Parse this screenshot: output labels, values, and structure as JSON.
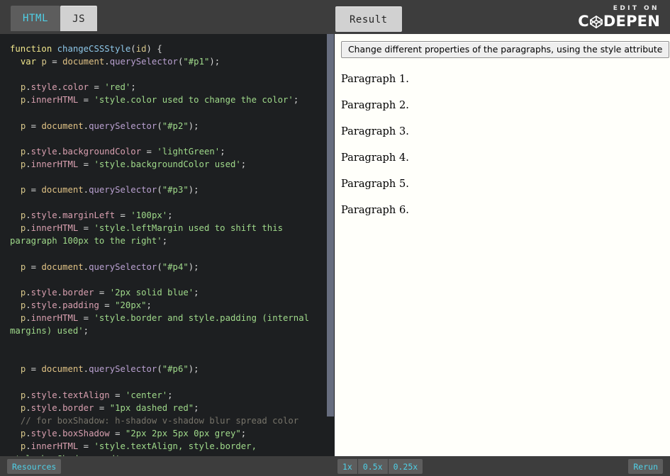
{
  "header": {
    "tabs": [
      {
        "label": "HTML",
        "active": false
      },
      {
        "label": "JS",
        "active": true
      }
    ],
    "result_tab_label": "Result",
    "brand": {
      "edit_on": "EDIT ON",
      "name_left": "C",
      "name_right": "DEPEN",
      "logo_icon": "codepen-logo-icon"
    }
  },
  "editor": {
    "language": "JavaScript",
    "lines": [
      {
        "tokens": [
          {
            "t": "function",
            "c": "kw"
          },
          {
            "t": " ",
            "c": "punc"
          },
          {
            "t": "changeCSSStyle",
            "c": "fn"
          },
          {
            "t": "(",
            "c": "punc"
          },
          {
            "t": "id",
            "c": "var"
          },
          {
            "t": ") {",
            "c": "punc"
          }
        ]
      },
      {
        "tokens": [
          {
            "t": "  ",
            "c": "punc"
          },
          {
            "t": "var",
            "c": "kw"
          },
          {
            "t": " ",
            "c": "punc"
          },
          {
            "t": "p",
            "c": "var"
          },
          {
            "t": " = ",
            "c": "op"
          },
          {
            "t": "document",
            "c": "obj"
          },
          {
            "t": ".",
            "c": "punc"
          },
          {
            "t": "querySelector",
            "c": "method"
          },
          {
            "t": "(",
            "c": "punc"
          },
          {
            "t": "\"#p1\"",
            "c": "str"
          },
          {
            "t": ");",
            "c": "punc"
          }
        ]
      },
      {
        "tokens": []
      },
      {
        "tokens": [
          {
            "t": "  ",
            "c": "punc"
          },
          {
            "t": "p",
            "c": "var"
          },
          {
            "t": ".",
            "c": "punc"
          },
          {
            "t": "style",
            "c": "prop"
          },
          {
            "t": ".",
            "c": "punc"
          },
          {
            "t": "color",
            "c": "prop"
          },
          {
            "t": " = ",
            "c": "op"
          },
          {
            "t": "'red'",
            "c": "str"
          },
          {
            "t": ";",
            "c": "punc"
          }
        ]
      },
      {
        "tokens": [
          {
            "t": "  ",
            "c": "punc"
          },
          {
            "t": "p",
            "c": "var"
          },
          {
            "t": ".",
            "c": "punc"
          },
          {
            "t": "innerHTML",
            "c": "prop"
          },
          {
            "t": " = ",
            "c": "op"
          },
          {
            "t": "'style.color used to change the color'",
            "c": "str"
          },
          {
            "t": ";",
            "c": "punc"
          }
        ]
      },
      {
        "tokens": []
      },
      {
        "tokens": [
          {
            "t": "  ",
            "c": "punc"
          },
          {
            "t": "p",
            "c": "var"
          },
          {
            "t": " = ",
            "c": "op"
          },
          {
            "t": "document",
            "c": "obj"
          },
          {
            "t": ".",
            "c": "punc"
          },
          {
            "t": "querySelector",
            "c": "method"
          },
          {
            "t": "(",
            "c": "punc"
          },
          {
            "t": "\"#p2\"",
            "c": "str"
          },
          {
            "t": ");",
            "c": "punc"
          }
        ]
      },
      {
        "tokens": []
      },
      {
        "tokens": [
          {
            "t": "  ",
            "c": "punc"
          },
          {
            "t": "p",
            "c": "var"
          },
          {
            "t": ".",
            "c": "punc"
          },
          {
            "t": "style",
            "c": "prop"
          },
          {
            "t": ".",
            "c": "punc"
          },
          {
            "t": "backgroundColor",
            "c": "prop"
          },
          {
            "t": " = ",
            "c": "op"
          },
          {
            "t": "'lightGreen'",
            "c": "str"
          },
          {
            "t": ";",
            "c": "punc"
          }
        ]
      },
      {
        "tokens": [
          {
            "t": "  ",
            "c": "punc"
          },
          {
            "t": "p",
            "c": "var"
          },
          {
            "t": ".",
            "c": "punc"
          },
          {
            "t": "innerHTML",
            "c": "prop"
          },
          {
            "t": " = ",
            "c": "op"
          },
          {
            "t": "'style.backgroundColor used'",
            "c": "str"
          },
          {
            "t": ";",
            "c": "punc"
          }
        ]
      },
      {
        "tokens": []
      },
      {
        "tokens": [
          {
            "t": "  ",
            "c": "punc"
          },
          {
            "t": "p",
            "c": "var"
          },
          {
            "t": " = ",
            "c": "op"
          },
          {
            "t": "document",
            "c": "obj"
          },
          {
            "t": ".",
            "c": "punc"
          },
          {
            "t": "querySelector",
            "c": "method"
          },
          {
            "t": "(",
            "c": "punc"
          },
          {
            "t": "\"#p3\"",
            "c": "str"
          },
          {
            "t": ");",
            "c": "punc"
          }
        ]
      },
      {
        "tokens": []
      },
      {
        "tokens": [
          {
            "t": "  ",
            "c": "punc"
          },
          {
            "t": "p",
            "c": "var"
          },
          {
            "t": ".",
            "c": "punc"
          },
          {
            "t": "style",
            "c": "prop"
          },
          {
            "t": ".",
            "c": "punc"
          },
          {
            "t": "marginLeft",
            "c": "prop"
          },
          {
            "t": " = ",
            "c": "op"
          },
          {
            "t": "'100px'",
            "c": "str"
          },
          {
            "t": ";",
            "c": "punc"
          }
        ]
      },
      {
        "tokens": [
          {
            "t": "  ",
            "c": "punc"
          },
          {
            "t": "p",
            "c": "var"
          },
          {
            "t": ".",
            "c": "punc"
          },
          {
            "t": "innerHTML",
            "c": "prop"
          },
          {
            "t": " = ",
            "c": "op"
          },
          {
            "t": "'style.leftMargin used to shift this paragraph 100px to the right'",
            "c": "str"
          },
          {
            "t": ";",
            "c": "punc"
          }
        ]
      },
      {
        "tokens": []
      },
      {
        "tokens": [
          {
            "t": "  ",
            "c": "punc"
          },
          {
            "t": "p",
            "c": "var"
          },
          {
            "t": " = ",
            "c": "op"
          },
          {
            "t": "document",
            "c": "obj"
          },
          {
            "t": ".",
            "c": "punc"
          },
          {
            "t": "querySelector",
            "c": "method"
          },
          {
            "t": "(",
            "c": "punc"
          },
          {
            "t": "\"#p4\"",
            "c": "str"
          },
          {
            "t": ");",
            "c": "punc"
          }
        ]
      },
      {
        "tokens": []
      },
      {
        "tokens": [
          {
            "t": "  ",
            "c": "punc"
          },
          {
            "t": "p",
            "c": "var"
          },
          {
            "t": ".",
            "c": "punc"
          },
          {
            "t": "style",
            "c": "prop"
          },
          {
            "t": ".",
            "c": "punc"
          },
          {
            "t": "border",
            "c": "prop"
          },
          {
            "t": " = ",
            "c": "op"
          },
          {
            "t": "'2px solid blue'",
            "c": "str"
          },
          {
            "t": ";",
            "c": "punc"
          }
        ]
      },
      {
        "tokens": [
          {
            "t": "  ",
            "c": "punc"
          },
          {
            "t": "p",
            "c": "var"
          },
          {
            "t": ".",
            "c": "punc"
          },
          {
            "t": "style",
            "c": "prop"
          },
          {
            "t": ".",
            "c": "punc"
          },
          {
            "t": "padding",
            "c": "prop"
          },
          {
            "t": " = ",
            "c": "op"
          },
          {
            "t": "\"20px\"",
            "c": "str"
          },
          {
            "t": ";",
            "c": "punc"
          }
        ]
      },
      {
        "tokens": [
          {
            "t": "  ",
            "c": "punc"
          },
          {
            "t": "p",
            "c": "var"
          },
          {
            "t": ".",
            "c": "punc"
          },
          {
            "t": "innerHTML",
            "c": "prop"
          },
          {
            "t": " = ",
            "c": "op"
          },
          {
            "t": "'style.border and style.padding (internal margins) used'",
            "c": "str"
          },
          {
            "t": ";",
            "c": "punc"
          }
        ]
      },
      {
        "tokens": []
      },
      {
        "tokens": []
      },
      {
        "tokens": [
          {
            "t": "  ",
            "c": "punc"
          },
          {
            "t": "p",
            "c": "var"
          },
          {
            "t": " = ",
            "c": "op"
          },
          {
            "t": "document",
            "c": "obj"
          },
          {
            "t": ".",
            "c": "punc"
          },
          {
            "t": "querySelector",
            "c": "method"
          },
          {
            "t": "(",
            "c": "punc"
          },
          {
            "t": "\"#p6\"",
            "c": "str"
          },
          {
            "t": ");",
            "c": "punc"
          }
        ]
      },
      {
        "tokens": []
      },
      {
        "tokens": [
          {
            "t": "  ",
            "c": "punc"
          },
          {
            "t": "p",
            "c": "var"
          },
          {
            "t": ".",
            "c": "punc"
          },
          {
            "t": "style",
            "c": "prop"
          },
          {
            "t": ".",
            "c": "punc"
          },
          {
            "t": "textAlign",
            "c": "prop"
          },
          {
            "t": " = ",
            "c": "op"
          },
          {
            "t": "'center'",
            "c": "str"
          },
          {
            "t": ";",
            "c": "punc"
          }
        ]
      },
      {
        "tokens": [
          {
            "t": "  ",
            "c": "punc"
          },
          {
            "t": "p",
            "c": "var"
          },
          {
            "t": ".",
            "c": "punc"
          },
          {
            "t": "style",
            "c": "prop"
          },
          {
            "t": ".",
            "c": "punc"
          },
          {
            "t": "border",
            "c": "prop"
          },
          {
            "t": " = ",
            "c": "op"
          },
          {
            "t": "\"1px dashed red\"",
            "c": "str"
          },
          {
            "t": ";",
            "c": "punc"
          }
        ]
      },
      {
        "tokens": [
          {
            "t": "  ",
            "c": "punc"
          },
          {
            "t": "// for boxShadow: h-shadow v-shadow blur spread color",
            "c": "comment"
          }
        ]
      },
      {
        "tokens": [
          {
            "t": "  ",
            "c": "punc"
          },
          {
            "t": "p",
            "c": "var"
          },
          {
            "t": ".",
            "c": "punc"
          },
          {
            "t": "style",
            "c": "prop"
          },
          {
            "t": ".",
            "c": "punc"
          },
          {
            "t": "boxShadow",
            "c": "prop"
          },
          {
            "t": " = ",
            "c": "op"
          },
          {
            "t": "\"2px 2px 5px 0px grey\"",
            "c": "str"
          },
          {
            "t": ";",
            "c": "punc"
          }
        ]
      },
      {
        "tokens": [
          {
            "t": "  ",
            "c": "punc"
          },
          {
            "t": "p",
            "c": "var"
          },
          {
            "t": ".",
            "c": "punc"
          },
          {
            "t": "innerHTML",
            "c": "prop"
          },
          {
            "t": " = ",
            "c": "op"
          },
          {
            "t": "'style.textAlign, style.border, style.bowShadow used'",
            "c": "str"
          },
          {
            "t": ";",
            "c": "punc"
          }
        ]
      }
    ]
  },
  "result": {
    "button_label": "Change different properties of the paragraphs, using the style attribute",
    "paragraphs": [
      "Paragraph 1.",
      "Paragraph 2.",
      "Paragraph 3.",
      "Paragraph 4.",
      "Paragraph 5.",
      "Paragraph 6."
    ]
  },
  "footer": {
    "resources_label": "Resources",
    "speed_options": [
      "1x",
      "0.5x",
      "0.25x"
    ],
    "rerun_label": "Rerun"
  },
  "colors": {
    "chrome_bg": "#3d3d3d",
    "tab_inactive_bg": "#5d5d5d",
    "tab_active_bg": "#d1d1d1",
    "accent_cyan": "#4fd0e7",
    "editor_bg": "#1d1f21",
    "result_bg": "#fffffa",
    "scrollbar_thumb": "#676d7f"
  }
}
